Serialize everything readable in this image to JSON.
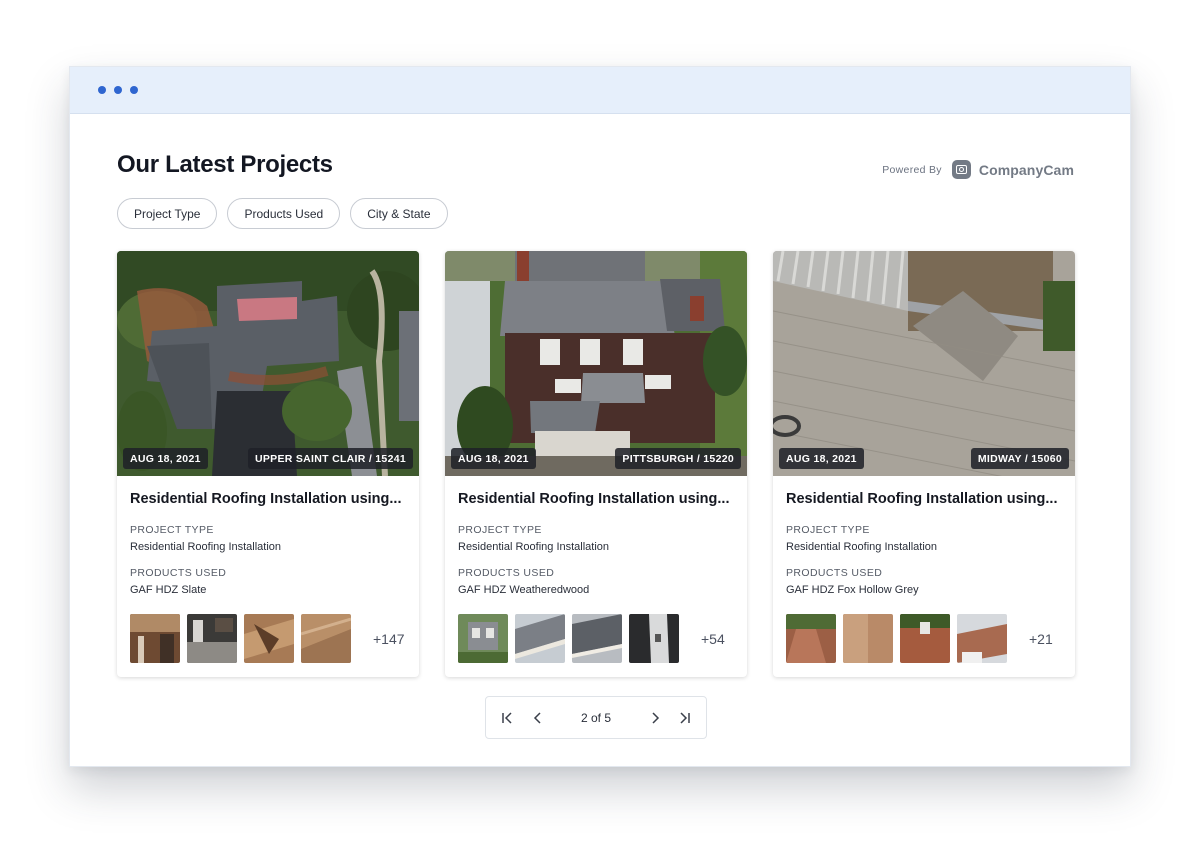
{
  "header": {
    "title": "Our Latest Projects",
    "powered_by": "Powered By",
    "brand": "CompanyCam",
    "brand_icon": "companycam-camera-icon"
  },
  "filters": [
    "Project Type",
    "Products Used",
    "City & State"
  ],
  "cards": [
    {
      "date": "AUG 18, 2021",
      "location": "UPPER SAINT CLAIR / 15241",
      "title": "Residential Roofing Installation using...",
      "project_type_label": "PROJECT TYPE",
      "project_type": "Residential Roofing Installation",
      "products_label": "PRODUCTS USED",
      "products": "GAF HDZ Slate",
      "more": "+147"
    },
    {
      "date": "AUG 18, 2021",
      "location": "PITTSBURGH / 15220",
      "title": "Residential Roofing Installation using...",
      "project_type_label": "PROJECT TYPE",
      "project_type": "Residential Roofing Installation",
      "products_label": "PRODUCTS USED",
      "products": "GAF HDZ Weatheredwood",
      "more": "+54"
    },
    {
      "date": "AUG 18, 2021",
      "location": "MIDWAY / 15060",
      "title": "Residential Roofing Installation using...",
      "project_type_label": "PROJECT TYPE",
      "project_type": "Residential Roofing Installation",
      "products_label": "PRODUCTS USED",
      "products": "GAF HDZ Fox Hollow Grey",
      "more": "+21"
    }
  ],
  "pagination": {
    "current": 2,
    "total": 5,
    "label": "2 of 5"
  },
  "colors": {
    "titlebar": "#e6effb",
    "titlebar_dots": "#2f66d0",
    "badge_bg": "#1e2128"
  }
}
